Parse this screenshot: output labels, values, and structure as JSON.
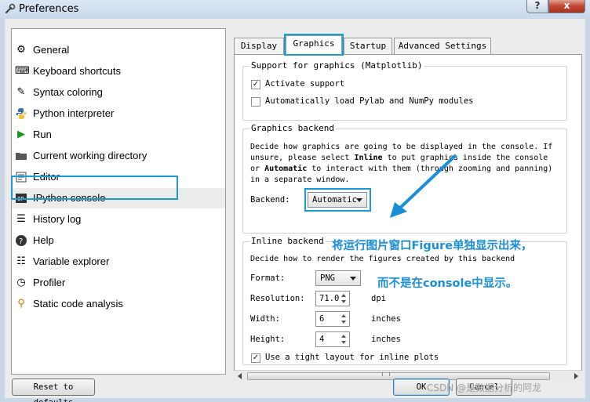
{
  "window": {
    "title": "Preferences",
    "help_btn": "?",
    "close_btn": "x"
  },
  "sidebar": {
    "items": [
      {
        "label": "General",
        "icon": "gears-icon"
      },
      {
        "label": "Keyboard shortcuts",
        "icon": "keyboard-icon"
      },
      {
        "label": "Syntax coloring",
        "icon": "brush-icon"
      },
      {
        "label": "Python interpreter",
        "icon": "python-icon"
      },
      {
        "label": "Run",
        "icon": "run-icon"
      },
      {
        "label": "Current working directory",
        "icon": "folder-icon"
      },
      {
        "label": "Editor",
        "icon": "editor-icon"
      },
      {
        "label": "IPython console",
        "icon": "ipython-icon"
      },
      {
        "label": "History log",
        "icon": "history-icon"
      },
      {
        "label": "Help",
        "icon": "help-icon"
      },
      {
        "label": "Variable explorer",
        "icon": "table-icon"
      },
      {
        "label": "Profiler",
        "icon": "profiler-icon"
      },
      {
        "label": "Static code analysis",
        "icon": "search-icon"
      }
    ],
    "selected": "IPython console"
  },
  "tabs": [
    {
      "label": "Display"
    },
    {
      "label": "Graphics"
    },
    {
      "label": "Startup"
    },
    {
      "label": "Advanced Settings"
    }
  ],
  "active_tab": "Graphics",
  "support": {
    "title": "Support for graphics (Matplotlib)",
    "activate_label": "Activate support",
    "activate_checked": true,
    "pylab_label": "Automatically load Pylab and NumPy modules",
    "pylab_checked": false
  },
  "backend": {
    "title": "Graphics backend",
    "desc_1": "Decide how graphics are going to be displayed in the console. If unsure, please select ",
    "desc_inline": "Inline",
    "desc_2": " to put graphics inside the console or ",
    "desc_auto": "Automatic",
    "desc_3": " to interact with them (through zooming and panning) in a separate window.",
    "label": "Backend:",
    "value": "Automatic"
  },
  "inline": {
    "title": "Inline backend",
    "desc": "Decide how to render the figures created by this backend",
    "format_label": "Format:",
    "format_value": "PNG",
    "resolution_label": "Resolution:",
    "resolution_value": "71.0",
    "resolution_unit": "dpi",
    "width_label": "Width:",
    "width_value": "6",
    "width_unit": "inches",
    "height_label": "Height:",
    "height_value": "4",
    "height_unit": "inches",
    "tight_label": "Use a tight layout for inline plots",
    "tight_checked": true
  },
  "annotation": {
    "line1": "将运行图片窗口Figure单独显示出来，",
    "line2": "而不是在console中显示。",
    "color": "#1a8fd8"
  },
  "buttons": {
    "reset": "Reset to defaults",
    "ok": "OK",
    "cancel": "Cancel"
  },
  "watermark": "CSDN @是数据分析的阿龙",
  "colors": {
    "highlight": "#1a9ad6",
    "titlebar": "#c9d8ea",
    "close": "#c44b36"
  }
}
